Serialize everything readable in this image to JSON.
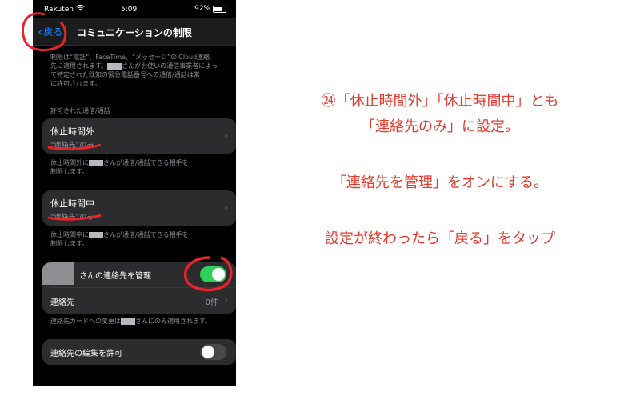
{
  "status": {
    "carrier": "Rakuten",
    "time": "5:09",
    "battery": "92%",
    "battery_level": 0.92
  },
  "nav": {
    "back": "戻る",
    "title": "コミュニケーションの制限"
  },
  "intro": {
    "line1": "制限は“電話”、FaceTime、“メッセージ”のiCloud連絡",
    "line2_a": "先に適用されます。",
    "line2_b": "さんがお使いの通信事業者によっ",
    "line3": "て特定された既知の緊急電話番号への通信/通話は常",
    "line4": "に許可されます。"
  },
  "allowed_header": "許可された通信/通話",
  "downtime_out": {
    "title": "休止時間外",
    "value": "“連絡先”のみ",
    "note_a": "休止時間外に",
    "note_b": "さんが通信/通話できる相手を",
    "note_c": "制限します。"
  },
  "downtime_in": {
    "title": "休止時間中",
    "value": "“連絡先”のみ",
    "note_a": "休止時間中に",
    "note_b": "さんが通信/通話できる相手を",
    "note_c": "制限します。"
  },
  "manage": {
    "label": "さんの連絡先を管理",
    "toggle_on": true
  },
  "contacts": {
    "label": "連絡先",
    "count": "0件"
  },
  "contacts_note": {
    "a": "連絡先カードへの変更は",
    "b": "さんにのみ適用されます。"
  },
  "edit": {
    "label": "連絡先の編集を許可",
    "toggle_on": false
  },
  "annotation": {
    "line1": "㉔「休止時間外」「休止時間中」とも",
    "line2": "「連絡先のみ」に設定。",
    "line3": "「連絡先を管理」をオンにする。",
    "line4": "設定が終わったら「戻る」をタップ"
  },
  "colors": {
    "accent": "#0a84ff",
    "toggle_on": "#30d158",
    "annotation": "#e5392d"
  }
}
